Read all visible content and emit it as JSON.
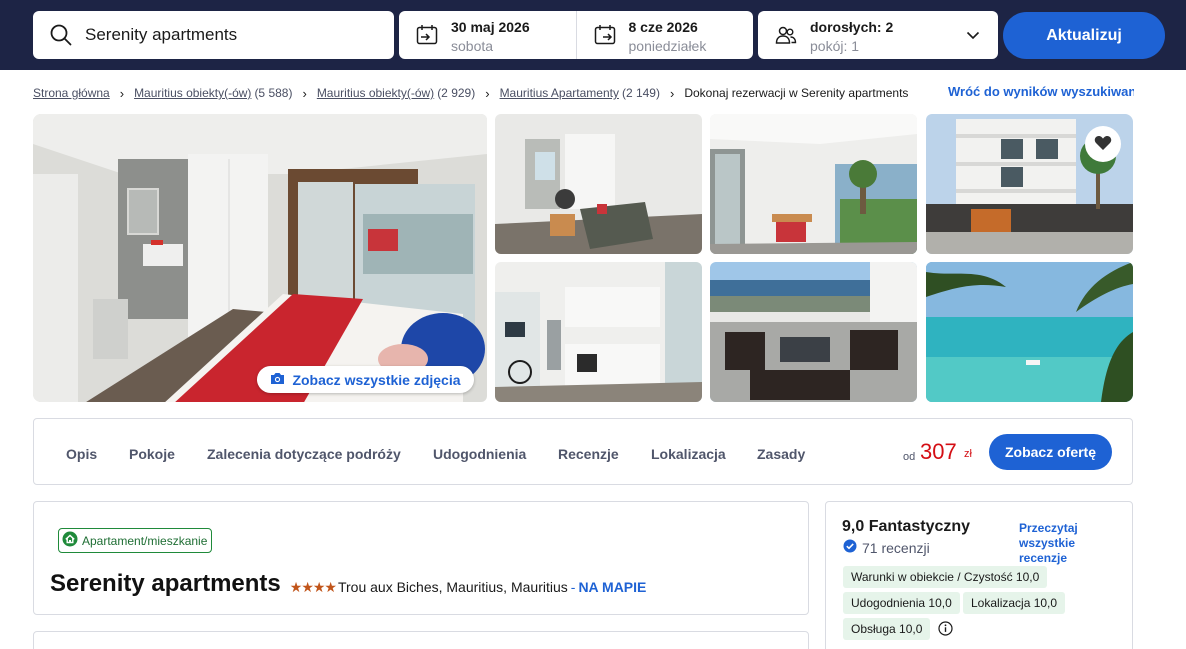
{
  "search": {
    "destination": "Serenity apartments",
    "checkin": {
      "date": "30 maj 2026",
      "weekday": "sobota"
    },
    "checkout": {
      "date": "8 cze 2026",
      "weekday": "poniedziałek"
    },
    "guests": {
      "adults": "dorosłych: 2",
      "rooms": "pokój: 1"
    },
    "update_label": "Aktualizuj"
  },
  "breadcrumb": [
    {
      "label": "Strona główna",
      "count": ""
    },
    {
      "label": "Mauritius obiekty(-ów)",
      "count": "(5 588)"
    },
    {
      "label": "Mauritius obiekty(-ów)",
      "count": "(2 929)"
    },
    {
      "label": "Mauritius Apartamenty",
      "count": "(2 149)"
    }
  ],
  "breadcrumb_current": "Dokonaj rezerwacji w Serenity apartments",
  "back_link": "Wróć do wyników wyszukiwania",
  "gallery": {
    "see_all_label": "Zobacz wszystkie zdjęcia",
    "photos": [
      "bedroom-photo",
      "living-room-photo",
      "balcony-dining-photo",
      "building-exterior-photo",
      "kitchen-photo",
      "terrace-photo",
      "beach-photo"
    ]
  },
  "tabs": [
    "Opis",
    "Pokoje",
    "Zalecenia dotyczące podróży",
    "Udogodnienia",
    "Recenzje",
    "Lokalizacja",
    "Zasady"
  ],
  "price": {
    "from": "od",
    "amount": "307",
    "currency": "zł",
    "offer_label": "Zobacz ofertę"
  },
  "property": {
    "type_badge": "Apartament/mieszkanie",
    "name": "Serenity apartments",
    "stars": 4,
    "location": "Trou aux Biches, Mauritius, Mauritius",
    "map_dash": "-",
    "map_link": "NA MAPIE"
  },
  "rating": {
    "score_label": "9,0 Fantastyczny",
    "reviews": "71 recenzji",
    "read_all": "Przeczytaj wszystkie recenzje",
    "chips": [
      "Warunki w obiekcie / Czystość 10,0",
      "Udogodnienia 10,0",
      "Lokalizacja 10,0",
      "Obsługa 10,0"
    ]
  },
  "colors": {
    "header_bg": "#1d2445",
    "accent": "#1e62d4",
    "price": "#d40e14",
    "chip_bg": "#e6f4ea"
  },
  "icons": [
    "search-icon",
    "calendar-in-icon",
    "calendar-out-icon",
    "guests-icon",
    "chevron-down-icon",
    "camera-icon",
    "heart-icon",
    "home-icon",
    "verified-icon",
    "info-icon"
  ]
}
